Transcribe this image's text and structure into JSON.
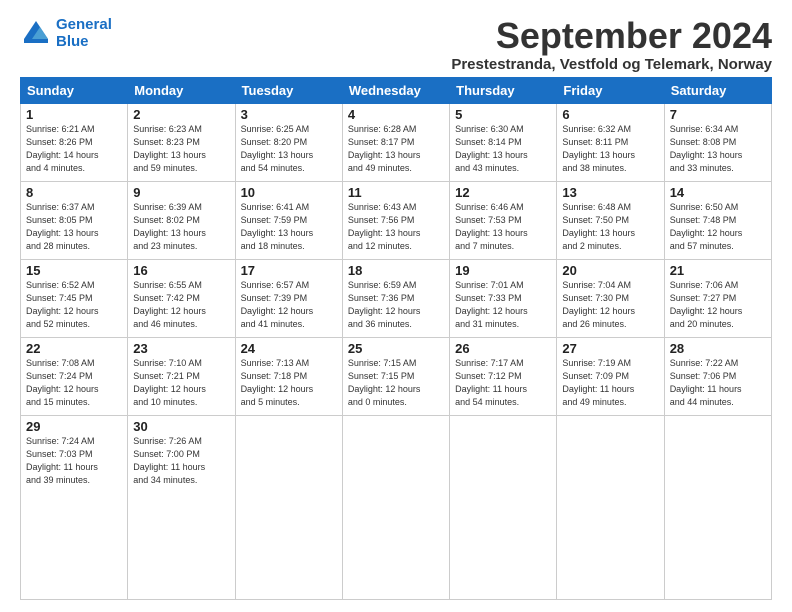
{
  "header": {
    "logo_line1": "General",
    "logo_line2": "Blue",
    "month_title": "September 2024",
    "subtitle": "Prestestranda, Vestfold og Telemark, Norway"
  },
  "days_of_week": [
    "Sunday",
    "Monday",
    "Tuesday",
    "Wednesday",
    "Thursday",
    "Friday",
    "Saturday"
  ],
  "weeks": [
    [
      {
        "day": "1",
        "info": "Sunrise: 6:21 AM\nSunset: 8:26 PM\nDaylight: 14 hours\nand 4 minutes."
      },
      {
        "day": "2",
        "info": "Sunrise: 6:23 AM\nSunset: 8:23 PM\nDaylight: 13 hours\nand 59 minutes."
      },
      {
        "day": "3",
        "info": "Sunrise: 6:25 AM\nSunset: 8:20 PM\nDaylight: 13 hours\nand 54 minutes."
      },
      {
        "day": "4",
        "info": "Sunrise: 6:28 AM\nSunset: 8:17 PM\nDaylight: 13 hours\nand 49 minutes."
      },
      {
        "day": "5",
        "info": "Sunrise: 6:30 AM\nSunset: 8:14 PM\nDaylight: 13 hours\nand 43 minutes."
      },
      {
        "day": "6",
        "info": "Sunrise: 6:32 AM\nSunset: 8:11 PM\nDaylight: 13 hours\nand 38 minutes."
      },
      {
        "day": "7",
        "info": "Sunrise: 6:34 AM\nSunset: 8:08 PM\nDaylight: 13 hours\nand 33 minutes."
      }
    ],
    [
      {
        "day": "8",
        "info": "Sunrise: 6:37 AM\nSunset: 8:05 PM\nDaylight: 13 hours\nand 28 minutes."
      },
      {
        "day": "9",
        "info": "Sunrise: 6:39 AM\nSunset: 8:02 PM\nDaylight: 13 hours\nand 23 minutes."
      },
      {
        "day": "10",
        "info": "Sunrise: 6:41 AM\nSunset: 7:59 PM\nDaylight: 13 hours\nand 18 minutes."
      },
      {
        "day": "11",
        "info": "Sunrise: 6:43 AM\nSunset: 7:56 PM\nDaylight: 13 hours\nand 12 minutes."
      },
      {
        "day": "12",
        "info": "Sunrise: 6:46 AM\nSunset: 7:53 PM\nDaylight: 13 hours\nand 7 minutes."
      },
      {
        "day": "13",
        "info": "Sunrise: 6:48 AM\nSunset: 7:50 PM\nDaylight: 13 hours\nand 2 minutes."
      },
      {
        "day": "14",
        "info": "Sunrise: 6:50 AM\nSunset: 7:48 PM\nDaylight: 12 hours\nand 57 minutes."
      }
    ],
    [
      {
        "day": "15",
        "info": "Sunrise: 6:52 AM\nSunset: 7:45 PM\nDaylight: 12 hours\nand 52 minutes."
      },
      {
        "day": "16",
        "info": "Sunrise: 6:55 AM\nSunset: 7:42 PM\nDaylight: 12 hours\nand 46 minutes."
      },
      {
        "day": "17",
        "info": "Sunrise: 6:57 AM\nSunset: 7:39 PM\nDaylight: 12 hours\nand 41 minutes."
      },
      {
        "day": "18",
        "info": "Sunrise: 6:59 AM\nSunset: 7:36 PM\nDaylight: 12 hours\nand 36 minutes."
      },
      {
        "day": "19",
        "info": "Sunrise: 7:01 AM\nSunset: 7:33 PM\nDaylight: 12 hours\nand 31 minutes."
      },
      {
        "day": "20",
        "info": "Sunrise: 7:04 AM\nSunset: 7:30 PM\nDaylight: 12 hours\nand 26 minutes."
      },
      {
        "day": "21",
        "info": "Sunrise: 7:06 AM\nSunset: 7:27 PM\nDaylight: 12 hours\nand 20 minutes."
      }
    ],
    [
      {
        "day": "22",
        "info": "Sunrise: 7:08 AM\nSunset: 7:24 PM\nDaylight: 12 hours\nand 15 minutes."
      },
      {
        "day": "23",
        "info": "Sunrise: 7:10 AM\nSunset: 7:21 PM\nDaylight: 12 hours\nand 10 minutes."
      },
      {
        "day": "24",
        "info": "Sunrise: 7:13 AM\nSunset: 7:18 PM\nDaylight: 12 hours\nand 5 minutes."
      },
      {
        "day": "25",
        "info": "Sunrise: 7:15 AM\nSunset: 7:15 PM\nDaylight: 12 hours\nand 0 minutes."
      },
      {
        "day": "26",
        "info": "Sunrise: 7:17 AM\nSunset: 7:12 PM\nDaylight: 11 hours\nand 54 minutes."
      },
      {
        "day": "27",
        "info": "Sunrise: 7:19 AM\nSunset: 7:09 PM\nDaylight: 11 hours\nand 49 minutes."
      },
      {
        "day": "28",
        "info": "Sunrise: 7:22 AM\nSunset: 7:06 PM\nDaylight: 11 hours\nand 44 minutes."
      }
    ],
    [
      {
        "day": "29",
        "info": "Sunrise: 7:24 AM\nSunset: 7:03 PM\nDaylight: 11 hours\nand 39 minutes."
      },
      {
        "day": "30",
        "info": "Sunrise: 7:26 AM\nSunset: 7:00 PM\nDaylight: 11 hours\nand 34 minutes."
      },
      {
        "day": "",
        "info": ""
      },
      {
        "day": "",
        "info": ""
      },
      {
        "day": "",
        "info": ""
      },
      {
        "day": "",
        "info": ""
      },
      {
        "day": "",
        "info": ""
      }
    ]
  ]
}
